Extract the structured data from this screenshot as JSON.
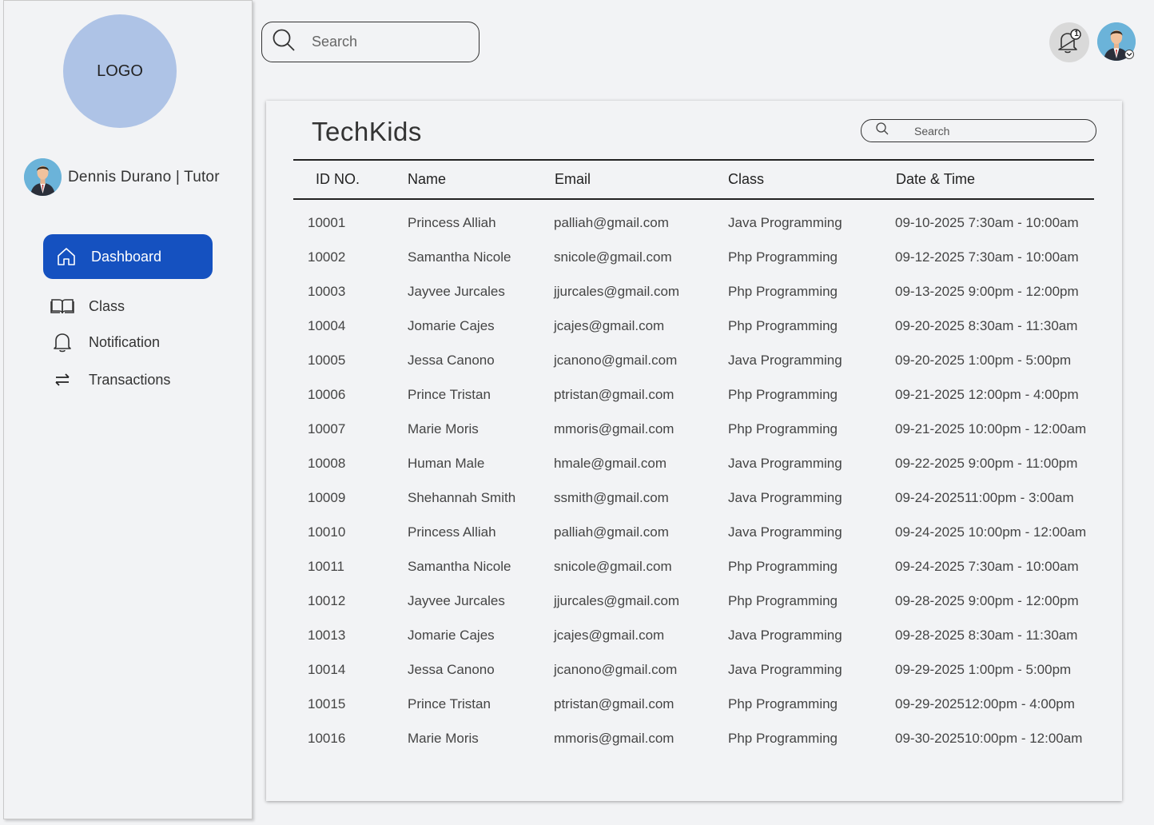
{
  "sidebar": {
    "logo_text": "LOGO",
    "profile_name": "Dennis Durano | Tutor",
    "nav": [
      {
        "label": "Dashboard",
        "icon": "home-icon",
        "active": true
      },
      {
        "label": "Class",
        "icon": "book-icon",
        "active": false
      },
      {
        "label": "Notification",
        "icon": "bell-icon",
        "active": false
      },
      {
        "label": "Transactions",
        "icon": "swap-arrows-icon",
        "active": false
      }
    ],
    "active_color": "#1551c0",
    "logo_color": "#aec3e6"
  },
  "topbar": {
    "search_placeholder": "Search",
    "notification_count": "1"
  },
  "card": {
    "title": "TechKids",
    "search_placeholder": "Search",
    "columns": [
      "ID NO.",
      "Name",
      "Email",
      "Class",
      "Date & Time"
    ],
    "rows": [
      [
        "10001",
        "Princess Alliah",
        "palliah@gmail.com",
        "Java Programming",
        "09-10-2025  7:30am - 10:00am"
      ],
      [
        "10002",
        "Samantha Nicole",
        "snicole@gmail.com",
        "Php Programming",
        "09-12-2025 7:30am - 10:00am"
      ],
      [
        "10003",
        "Jayvee Jurcales",
        "jjurcales@gmail.com",
        "Php Programming",
        "09-13-2025 9:00pm - 12:00pm"
      ],
      [
        "10004",
        "Jomarie Cajes",
        "jcajes@gmail.com",
        "Php Programming",
        "09-20-2025 8:30am - 11:30am"
      ],
      [
        "10005",
        "Jessa Canono",
        "jcanono@gmail.com",
        "Java Programming",
        "09-20-2025 1:00pm - 5:00pm"
      ],
      [
        "10006",
        "Prince Tristan",
        "ptristan@gmail.com",
        "Php Programming",
        "09-21-2025 12:00pm - 4:00pm"
      ],
      [
        "10007",
        "Marie Moris",
        "mmoris@gmail.com",
        "Php Programming",
        "09-21-2025 10:00pm - 12:00am"
      ],
      [
        "10008",
        "Human Male",
        "hmale@gmail.com",
        "Java Programming",
        "09-22-2025 9:00pm - 11:00pm"
      ],
      [
        "10009",
        "Shehannah Smith",
        "ssmith@gmail.com",
        "Java Programming",
        "09-24-202511:00pm - 3:00am"
      ],
      [
        "10010",
        "Princess Alliah",
        "palliah@gmail.com",
        "Java Programming",
        "09-24-2025 10:00pm - 12:00am"
      ],
      [
        "10011",
        "Samantha Nicole",
        "snicole@gmail.com",
        "Php Programming",
        "09-24-2025 7:30am - 10:00am"
      ],
      [
        "10012",
        "Jayvee Jurcales",
        "jjurcales@gmail.com",
        "Php Programming",
        "09-28-2025 9:00pm - 12:00pm"
      ],
      [
        "10013",
        "Jomarie Cajes",
        "jcajes@gmail.com",
        "Java Programming",
        " 09-28-2025 8:30am - 11:30am"
      ],
      [
        "10014",
        "Jessa Canono",
        "jcanono@gmail.com",
        "Java Programming",
        "09-29-2025 1:00pm - 5:00pm"
      ],
      [
        "10015",
        "Prince Tristan",
        "ptristan@gmail.com",
        "Php Programming",
        "09-29-202512:00pm - 4:00pm"
      ],
      [
        "10016",
        "Marie Moris",
        "mmoris@gmail.com",
        "Php Programming",
        "09-30-202510:00pm - 12:00am"
      ]
    ]
  }
}
